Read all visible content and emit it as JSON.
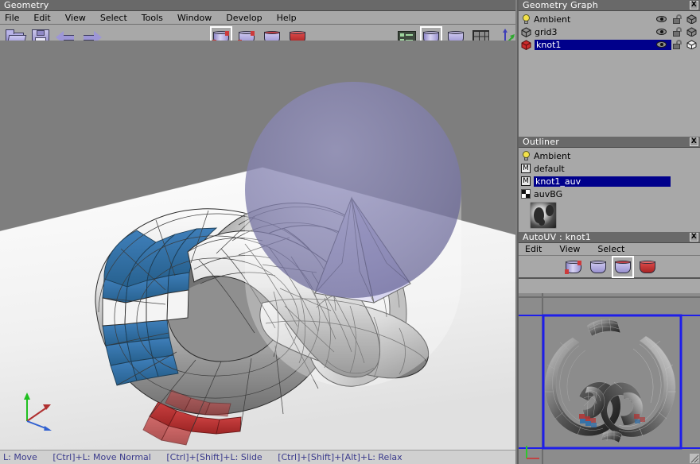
{
  "app": {
    "title": "Geometry",
    "menu": [
      "File",
      "Edit",
      "View",
      "Select",
      "Tools",
      "Window",
      "Develop",
      "Help"
    ]
  },
  "toolbar": {
    "open_label": "folder-open",
    "save_label": "save",
    "undo_label": "undo",
    "redo_label": "redo",
    "mode_vertex": "Vertex",
    "mode_edge": "Edge",
    "mode_face": "Face",
    "mode_body": "Body",
    "console_label": "Console",
    "shade_smooth": "Smooth Shading",
    "shade_flat": "Flat Shading",
    "grid_label": "Show Grid",
    "axes_label": "Show Axes",
    "selected_mode": "Vertex",
    "selected_shade": "Smooth Shading"
  },
  "statusbar": {
    "hints": [
      "L: Move",
      "[Ctrl]+L: Move Normal",
      "[Ctrl]+[Shift]+L: Slide",
      "[Ctrl]+[Shift]+[Alt]+L: Relax"
    ]
  },
  "geometry_graph": {
    "title": "Geometry Graph",
    "close": "X",
    "rows": [
      {
        "name": "Ambient",
        "icon": "light-bulb-icon",
        "selected": false,
        "visible": true,
        "locked": false,
        "wire": false
      },
      {
        "name": "grid3",
        "icon": "gray-cube-icon",
        "selected": false,
        "visible": true,
        "locked": false,
        "wire": false
      },
      {
        "name": "knot1",
        "icon": "red-cube-icon",
        "selected": true,
        "visible": true,
        "locked": false,
        "wire": true
      }
    ]
  },
  "outliner": {
    "title": "Outliner",
    "close": "X",
    "rows": [
      {
        "name": "Ambient",
        "icon": "light-bulb-icon",
        "selected": false
      },
      {
        "name": "default",
        "icon": "material-icon",
        "selected": false
      },
      {
        "name": "knot1_auv",
        "icon": "material-icon",
        "selected": true
      },
      {
        "name": "auvBG",
        "icon": "checker-icon",
        "selected": false
      }
    ],
    "thumbnail_label": "auvBG-texture-preview"
  },
  "autouv": {
    "title": "AutoUV : knot1",
    "close": "X",
    "menu": [
      "Edit",
      "View",
      "Select"
    ],
    "mode_vertex": "Vertex",
    "mode_edge": "Edge",
    "mode_face": "Face",
    "mode_body": "Body",
    "selected_mode": "Face",
    "axes_label": "uv-axes-indicator",
    "resize_label": "resize-grip"
  },
  "colors": {
    "panel_bg": "#a8a8a8",
    "titlebar_bg": "#696969",
    "selection_blue": "#00008b",
    "uv_border": "#1e1eea",
    "face_select_red": "#b03030",
    "face_select_blue": "#2f6ea8",
    "status_text": "#3a3a8c",
    "viewport_bg": "#7e7e7e"
  }
}
